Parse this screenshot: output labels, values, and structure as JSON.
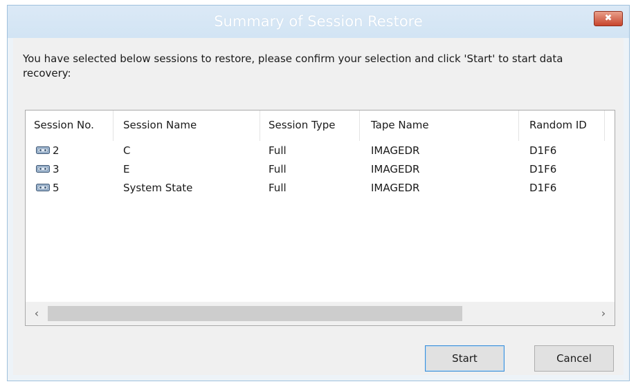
{
  "window": {
    "title": "Summary of Session Restore",
    "close_label": "✖"
  },
  "message": "You have selected below sessions to restore, please confirm your selection and click 'Start' to start data recovery:",
  "table": {
    "columns": [
      "Session No.",
      "Session Name",
      "Session Type",
      "Tape Name",
      "Random ID"
    ],
    "rows": [
      {
        "icon": "tape-icon",
        "session_no": "2",
        "session_name": "C",
        "session_type": "Full",
        "tape_name": "IMAGEDR",
        "random_id": "D1F6"
      },
      {
        "icon": "tape-icon",
        "session_no": "3",
        "session_name": "E",
        "session_type": "Full",
        "tape_name": "IMAGEDR",
        "random_id": "D1F6"
      },
      {
        "icon": "tape-icon",
        "session_no": "5",
        "session_name": "System State",
        "session_type": "Full",
        "tape_name": "IMAGEDR",
        "random_id": "D1F6"
      }
    ]
  },
  "scrollbar": {
    "left_arrow": "‹",
    "right_arrow": "›"
  },
  "buttons": {
    "start": "Start",
    "cancel": "Cancel"
  },
  "colors": {
    "title_bar": "#d2e4f4",
    "close_button": "#c7452d",
    "default_button_border": "#3c8fd8"
  }
}
